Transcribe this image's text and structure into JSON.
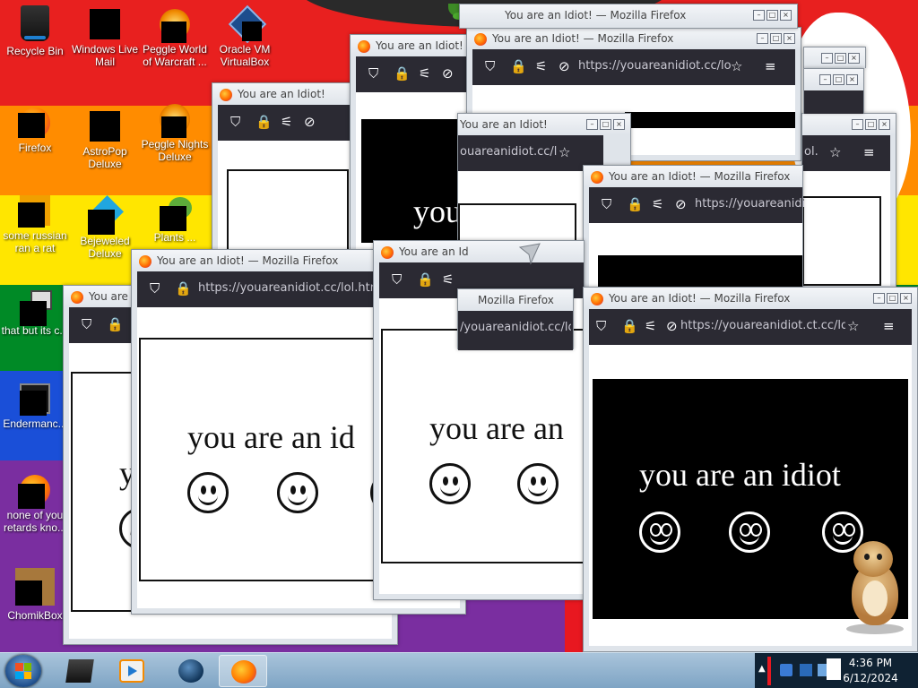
{
  "desktop": {
    "stripe_colors": [
      "#e8201f",
      "#ff8c00",
      "#ffe600",
      "#008a26",
      "#1a4fd8",
      "#7a2ea0"
    ],
    "overlay_letter": "h",
    "icons": [
      {
        "name": "recycle-bin",
        "label": "Recycle Bin",
        "icon": "recycle-bin-icon"
      },
      {
        "name": "windows-live-mail",
        "label": "Windows Live Mail",
        "icon": "mail-icon"
      },
      {
        "name": "peggle-world-of-warcraft",
        "label": "Peggle World of Warcraft ...",
        "icon": "peggle-icon"
      },
      {
        "name": "oracle-vm-virtualbox",
        "label": "Oracle VM VirtualBox",
        "icon": "virtualbox-icon"
      },
      {
        "name": "firefox",
        "label": "Firefox",
        "icon": "firefox-icon"
      },
      {
        "name": "astropop-deluxe",
        "label": "AstroPop Deluxe",
        "icon": "astropop-icon"
      },
      {
        "name": "peggle-nights-deluxe",
        "label": "Peggle Nights Deluxe",
        "icon": "peggle-icon"
      },
      {
        "name": "some-russian-ran-a-rat",
        "label": "some russian ran a rat",
        "icon": "document-icon"
      },
      {
        "name": "bejeweled-deluxe",
        "label": "Bejeweled Deluxe",
        "icon": "bejeweled-icon"
      },
      {
        "name": "plants-vs-zombies",
        "label": "Plants ...",
        "icon": "plants-icon"
      },
      {
        "name": "that-but-its",
        "label": "that but its c...",
        "icon": "windows-icon"
      },
      {
        "name": "enderman",
        "label": "Endermanc...",
        "icon": "app-icon"
      },
      {
        "name": "none-of-you",
        "label": "none of you retards kno...",
        "icon": "firefox-icon"
      },
      {
        "name": "chomikbox",
        "label": "ChomikBox",
        "icon": "hamster-icon"
      }
    ]
  },
  "browser": {
    "app_name": "Mozilla Firefox",
    "page_title": "You are an Idiot!",
    "full_title": "You are an Idiot! — Mozilla Firefox",
    "title_partial": "You are an Id",
    "title_short": "You are",
    "urls": {
      "lol_html": "https://youareanidiot.cc/lol.html",
      "lol": "https://youareanidiot.cc/lol.",
      "lol_nocc": "https://youareanidiot.cc/lol",
      "ct_cc": "https://youareanidiot.ct.cc/lol.",
      "partial_a": "/youareanidiot.cc/lol",
      "partial_b": "ouareanidiot.cc/lol.",
      "partial_c": "https://youareanidio",
      "partial_d": "ol."
    },
    "message": "you are an idiot",
    "message_short": "you are an",
    "message_clip": "you are an id",
    "message_you": "you",
    "window_controls": {
      "minimize": "–",
      "maximize": "□",
      "close": "×"
    },
    "toolbar_icons": [
      "shield-icon",
      "lock-icon",
      "permissions-icon",
      "tracking-protection-icon",
      "bookmark-star-icon",
      "menu-icon"
    ]
  },
  "glyphs": {
    "shield": "⛉",
    "lock": "🔒",
    "perm": "⚟",
    "track": "⊘",
    "star": "☆",
    "menu": "≡"
  },
  "taskbar": {
    "pinned": [
      {
        "name": "taskbar-app-1",
        "icon": "app-icon"
      },
      {
        "name": "taskbar-media-player",
        "icon": "media-player-icon"
      },
      {
        "name": "taskbar-globe",
        "icon": "globe-icon"
      },
      {
        "name": "taskbar-firefox",
        "icon": "firefox-icon",
        "active": true
      }
    ],
    "tray_arrow": "▲",
    "clock_time": "4:36 PM",
    "clock_date": "6/12/2024"
  }
}
